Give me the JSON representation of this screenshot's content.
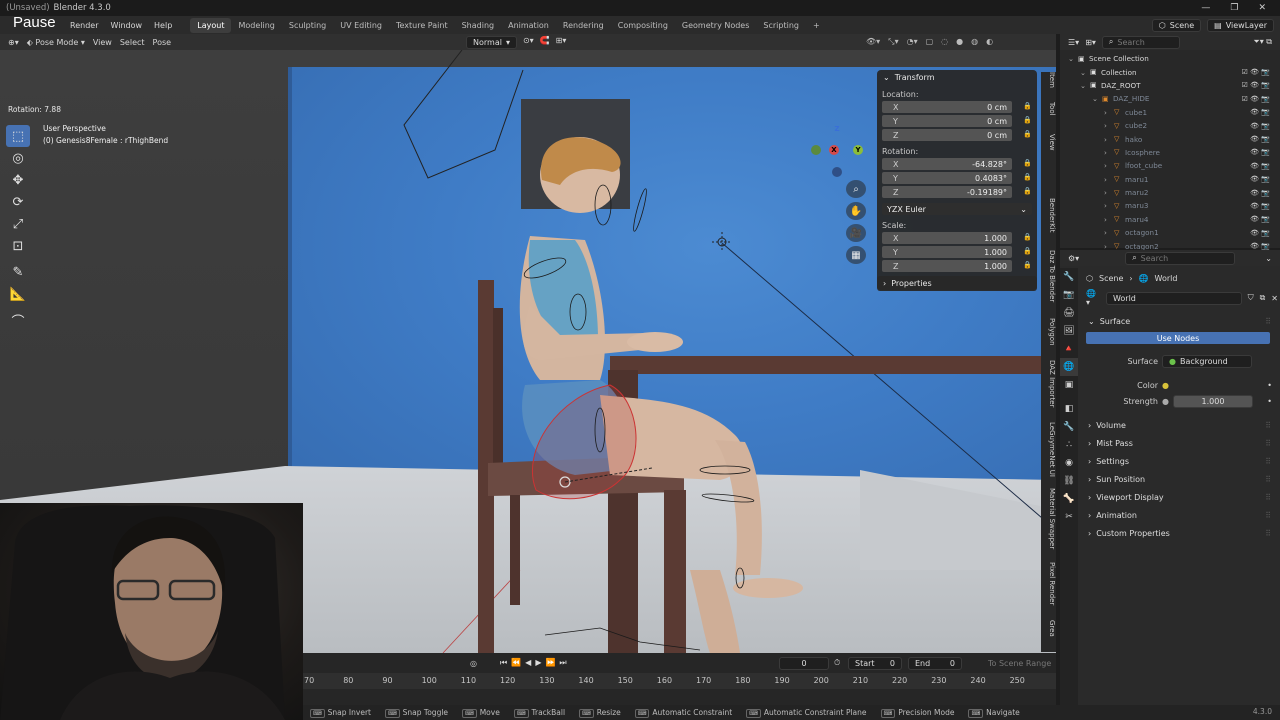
{
  "app": {
    "unsaved": "(Unsaved)",
    "title": "Blender 4.3.0",
    "pause_label": "Pause"
  },
  "menu": [
    "Render",
    "Window",
    "Help"
  ],
  "workspaces": [
    "Layout",
    "Modeling",
    "Sculpting",
    "UV Editing",
    "Texture Paint",
    "Shading",
    "Animation",
    "Rendering",
    "Compositing",
    "Geometry Nodes",
    "Scripting",
    "+"
  ],
  "topbar_right": {
    "scene": "Scene",
    "view_layer": "ViewLayer"
  },
  "viewport_header": {
    "mode": "Pose Mode",
    "items": [
      "View",
      "Select",
      "Pose"
    ],
    "orientation": "Normal"
  },
  "viewport": {
    "rotation_readout": "Rotation: 7.88",
    "perspective": "User Perspective",
    "object_info": "(0) Genesis8Female : rThighBend"
  },
  "gizmo": {
    "z": "Z",
    "x": "X",
    "y": "Y"
  },
  "transform_panel": {
    "title": "Transform",
    "location_label": "Location:",
    "location": [
      {
        "axis": "X",
        "value": "0 cm"
      },
      {
        "axis": "Y",
        "value": "0 cm"
      },
      {
        "axis": "Z",
        "value": "0 cm"
      }
    ],
    "rotation_label": "Rotation:",
    "rotation": [
      {
        "axis": "X",
        "value": "-64.828°"
      },
      {
        "axis": "Y",
        "value": "0.4083°"
      },
      {
        "axis": "Z",
        "value": "-0.19189°"
      }
    ],
    "rotation_mode": "YZX Euler",
    "scale_label": "Scale:",
    "scale": [
      {
        "axis": "X",
        "value": "1.000"
      },
      {
        "axis": "Y",
        "value": "1.000"
      },
      {
        "axis": "Z",
        "value": "1.000"
      }
    ],
    "properties_label": "Properties"
  },
  "sidebar_tabs": [
    "Item",
    "Tool",
    "View",
    "BenderKit",
    "Daz To Blender",
    "Polygon",
    "DAZ Importer",
    "LeGuymeNet UI",
    "Material Swapper",
    "Pixel Render",
    "Grea"
  ],
  "timeline": {
    "current_frame": "0",
    "start_label": "Start",
    "start": "0",
    "end_label": "End",
    "end": "0",
    "to_scene_range": "To Scene Range",
    "ticks": [
      "70",
      "80",
      "90",
      "100",
      "110",
      "120",
      "130",
      "140",
      "150",
      "160",
      "170",
      "180",
      "190",
      "200",
      "210",
      "220",
      "230",
      "240",
      "250"
    ]
  },
  "statusbar": [
    "Snap Invert",
    "Snap Toggle",
    "Move",
    "TrackBall",
    "Resize",
    "Automatic Constraint",
    "Automatic Constraint Plane",
    "Precision Mode",
    "Navigate"
  ],
  "version": "4.3.0",
  "outliner": {
    "search_placeholder": "Search",
    "rows": [
      {
        "name": "Scene Collection",
        "indent": 0,
        "dim": false
      },
      {
        "name": "Collection",
        "indent": 1,
        "dim": false
      },
      {
        "name": "DAZ_ROOT",
        "indent": 1,
        "dim": false
      },
      {
        "name": "DAZ_HIDE",
        "indent": 2,
        "dim": true
      },
      {
        "name": "cube1",
        "indent": 3,
        "dim": true
      },
      {
        "name": "cube2",
        "indent": 3,
        "dim": true
      },
      {
        "name": "hako",
        "indent": 3,
        "dim": true
      },
      {
        "name": "Icosphere",
        "indent": 3,
        "dim": true
      },
      {
        "name": "lfoot_cube",
        "indent": 3,
        "dim": true
      },
      {
        "name": "maru1",
        "indent": 3,
        "dim": true
      },
      {
        "name": "maru2",
        "indent": 3,
        "dim": true
      },
      {
        "name": "maru3",
        "indent": 3,
        "dim": true
      },
      {
        "name": "maru4",
        "indent": 3,
        "dim": true
      },
      {
        "name": "octagon1",
        "indent": 3,
        "dim": true
      },
      {
        "name": "octagon2",
        "indent": 3,
        "dim": true
      }
    ]
  },
  "properties": {
    "search_placeholder": "Search",
    "breadcrumb": [
      "Scene",
      "World"
    ],
    "world_name": "World",
    "surface_section": "Surface",
    "use_nodes": "Use Nodes",
    "surface_label": "Surface",
    "surface_value": "Background",
    "color_label": "Color",
    "strength_label": "Strength",
    "strength_value": "1.000",
    "sections": [
      "Volume",
      "Mist Pass",
      "Settings",
      "Sun Position",
      "Viewport Display",
      "Animation",
      "Custom Properties"
    ]
  }
}
